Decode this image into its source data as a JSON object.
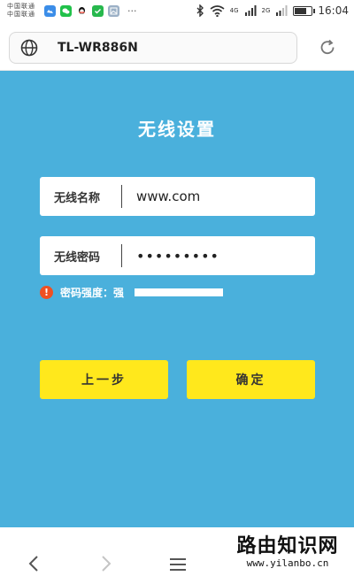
{
  "status_bar": {
    "carrier_line1": "中国联通",
    "carrier_line2": "中国联通",
    "apps": [
      "photos-icon",
      "wechat-icon",
      "qq-icon",
      "wechat-pay-icon",
      "gallery-icon"
    ],
    "more": "···",
    "network_4g": "4G",
    "network_2g": "2G",
    "time": "16:04"
  },
  "browser": {
    "url": "TL-WR886N",
    "icons": [
      "globe-icon",
      "refresh-icon"
    ]
  },
  "page": {
    "title": "无线设置",
    "ssid_label": "无线名称",
    "ssid_value": "www.com",
    "password_label": "无线密码",
    "password_value": "•••••••••",
    "strength_label": "密码强度：强",
    "strength_level": 1.0,
    "prev_button": "上一步",
    "confirm_button": "确定"
  },
  "colors": {
    "background": "#4ab0dc",
    "button": "#ffe81c",
    "warning": "#f05022"
  },
  "nav": {
    "icons": [
      "back-icon",
      "forward-icon",
      "menu-icon"
    ]
  },
  "watermark": {
    "title": "路由知识网",
    "url": "www.yilanbo.cn"
  }
}
